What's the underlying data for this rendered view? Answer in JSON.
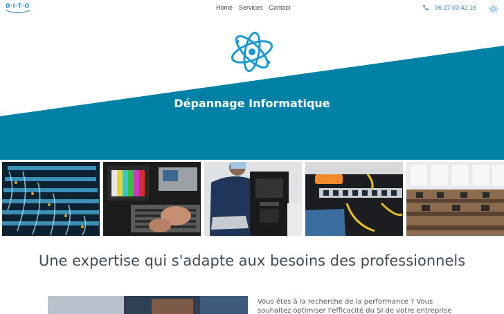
{
  "brand": {
    "logo_text": "D·I·T·O"
  },
  "nav": {
    "items": [
      "Home",
      "Services",
      "Contact"
    ]
  },
  "contact": {
    "phone": "06 27 03 42 16"
  },
  "hero": {
    "title": "Dépannage Informatique"
  },
  "section": {
    "heading": "Une expertise qui s'adapte aux besoins des professionnels",
    "paragraph_line1": "Vous êtes à la recherche de la performance ? Vous",
    "paragraph_line2": "souhaitez optimiser l'efficacité du SI de votre entreprise"
  },
  "colors": {
    "teal": "#0181a6",
    "logo_blue": "#2f86b5",
    "heading": "#3e4a56"
  },
  "icons": {
    "phone": "phone-icon",
    "theme": "sun-icon",
    "hero": "atom-icon"
  }
}
